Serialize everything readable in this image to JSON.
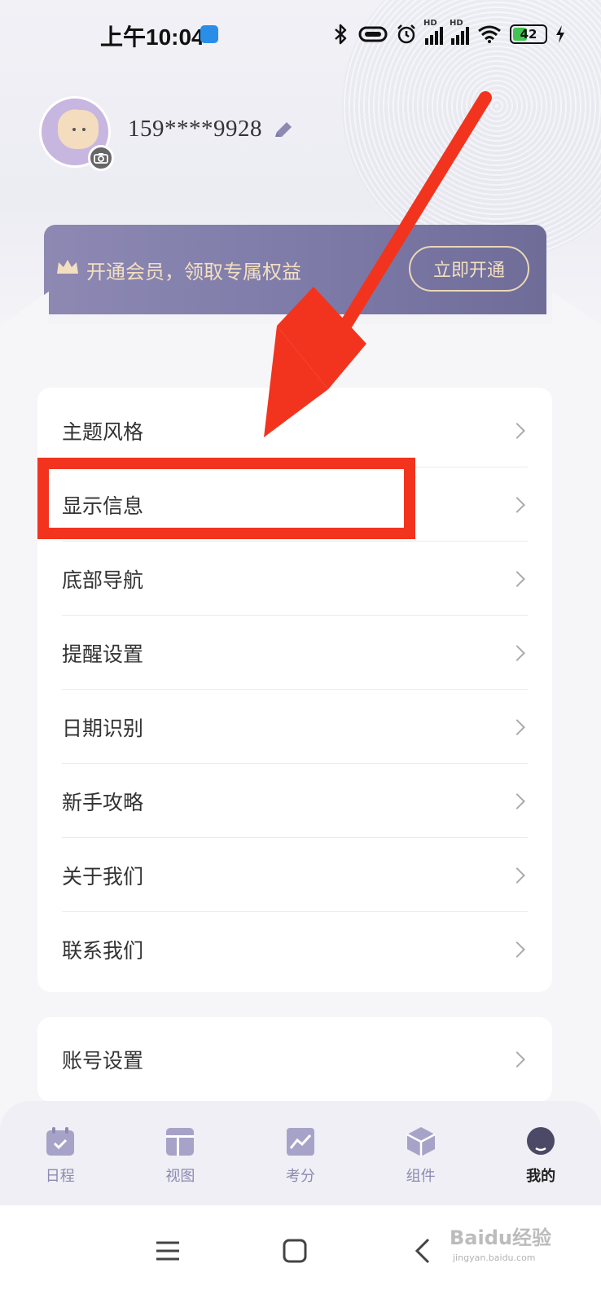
{
  "status_bar": {
    "time": "上午10:04",
    "network_1": "HD",
    "network_2": "HD",
    "battery": "42"
  },
  "profile": {
    "phone": "159****9928"
  },
  "vip_banner": {
    "text": "开通会员，领取专属权益",
    "button": "立即开通"
  },
  "settings": {
    "items": [
      {
        "label": "主题风格"
      },
      {
        "label": "显示信息"
      },
      {
        "label": "底部导航"
      },
      {
        "label": "提醒设置"
      },
      {
        "label": "日期识别"
      },
      {
        "label": "新手攻略"
      },
      {
        "label": "关于我们"
      },
      {
        "label": "联系我们"
      }
    ]
  },
  "account": {
    "label": "账号设置"
  },
  "tabs": [
    {
      "label": "日程",
      "icon": "calendar-icon"
    },
    {
      "label": "视图",
      "icon": "layout-icon"
    },
    {
      "label": "考分",
      "icon": "chart-icon"
    },
    {
      "label": "组件",
      "icon": "cube-icon"
    },
    {
      "label": "我的",
      "icon": "profile-icon",
      "active": true
    }
  ],
  "watermark": {
    "text": "Baidu经验",
    "sub": "jingyan.baidu.com"
  },
  "colors": {
    "accent": "#8d89b3",
    "banner_gold": "#f2dfc0",
    "annotation_red": "#f2341f"
  }
}
